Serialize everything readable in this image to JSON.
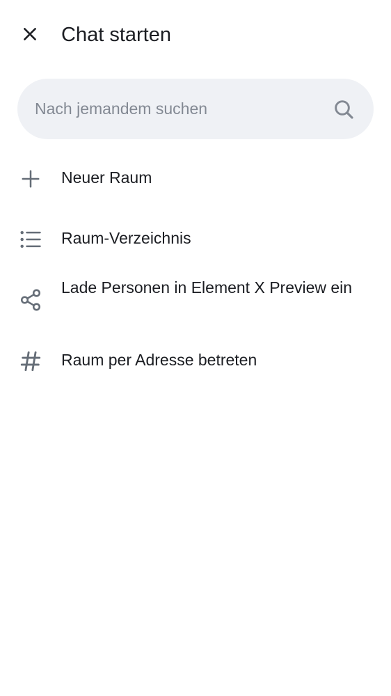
{
  "header": {
    "close_icon": "close-icon",
    "title": "Chat starten"
  },
  "search": {
    "placeholder": "Nach jemandem suchen",
    "icon": "search-icon"
  },
  "menu": {
    "items": [
      {
        "icon": "plus-icon",
        "label": "Neuer Raum"
      },
      {
        "icon": "list-icon",
        "label": "Raum-Verzeichnis"
      },
      {
        "icon": "share-icon",
        "label": "Lade Personen in Element X Preview ein"
      },
      {
        "icon": "hashtag-icon",
        "label": "Raum per Adresse betreten"
      }
    ]
  },
  "colors": {
    "text": "#1b1d22",
    "icon": "#656d77",
    "search_bg": "#eff1f5",
    "placeholder": "#838993"
  }
}
